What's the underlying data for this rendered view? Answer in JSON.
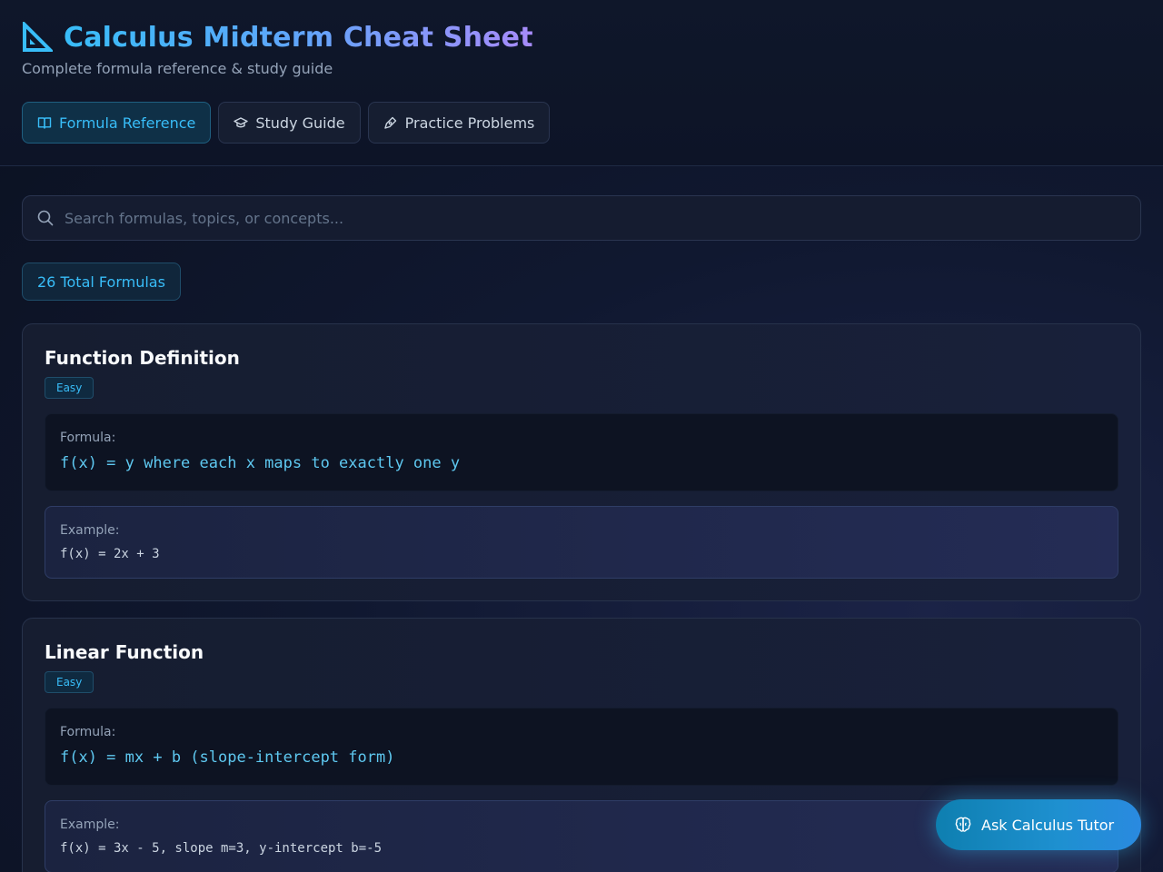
{
  "header": {
    "title": "Calculus Midterm Cheat Sheet",
    "subtitle": "Complete formula reference & study guide",
    "tabs": [
      {
        "label": "Formula Reference",
        "icon": "book-icon",
        "active": true
      },
      {
        "label": "Study Guide",
        "icon": "graduation-cap-icon",
        "active": false
      },
      {
        "label": "Practice Problems",
        "icon": "pen-icon",
        "active": false
      }
    ]
  },
  "search": {
    "placeholder": "Search formulas, topics, or concepts..."
  },
  "stats": {
    "total_label": "26 Total Formulas"
  },
  "labels": {
    "formula": "Formula:",
    "example": "Example:"
  },
  "formulas": [
    {
      "title": "Function Definition",
      "difficulty": "Easy",
      "formula": "f(x) = y where each x maps to exactly one y",
      "example": "f(x) = 2x + 3"
    },
    {
      "title": "Linear Function",
      "difficulty": "Easy",
      "formula": "f(x) = mx + b (slope-intercept form)",
      "example": "f(x) = 3x - 5, slope m=3, y-intercept b=-5"
    }
  ],
  "tutor": {
    "label": "Ask Calculus Tutor",
    "icon": "brain-icon"
  },
  "colors": {
    "accent": "#38bdf8",
    "secondary": "#a78bfa",
    "background": "#0b1120"
  }
}
